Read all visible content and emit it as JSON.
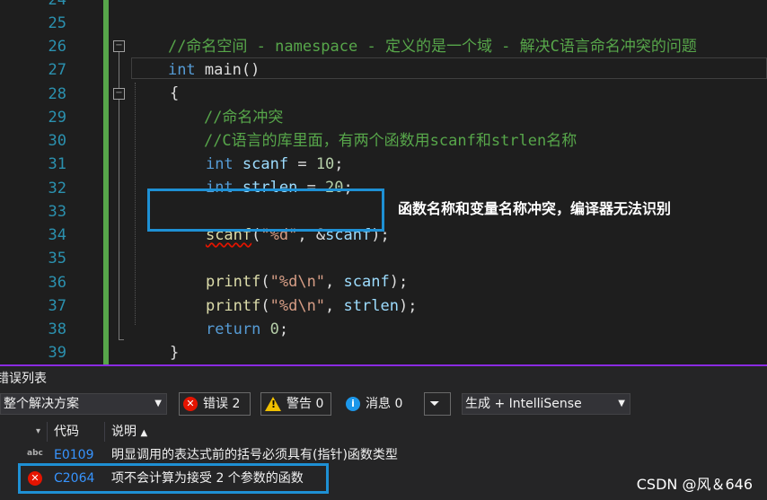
{
  "editor": {
    "line_numbers": [
      "24",
      "25",
      "26",
      "27",
      "28",
      "29",
      "30",
      "31",
      "32",
      "33",
      "34",
      "35",
      "36",
      "37",
      "38",
      "39"
    ],
    "lines": {
      "l25": {
        "comment": "//命名空间 - namespace - 定义的是一个域 - 解决C语言命名冲突的问题"
      },
      "l26": {
        "kw": "int",
        "rest": " main()"
      },
      "l27": {
        "text": "{"
      },
      "l28": {
        "comment": "//命名冲突"
      },
      "l29": {
        "comment": "//C语言的库里面，有两个函数用scanf和strlen名称"
      },
      "l30": {
        "kw": "int",
        "var": " scanf",
        "op": " = ",
        "num": "10",
        "end": ";"
      },
      "l31": {
        "kw": "int",
        "var": " strlen",
        "op": " = ",
        "num": "20",
        "end": ";"
      },
      "l33": {
        "fn": "scanf",
        "p1": "(",
        "str": "\"%d\"",
        "p2": ", &",
        "var": "scanf",
        "end": ");"
      },
      "l35": {
        "fn": "printf",
        "p1": "(",
        "str": "\"%d\\n\"",
        "p2": ", ",
        "var": "scanf",
        "end": ");"
      },
      "l36": {
        "fn": "printf",
        "p1": "(",
        "str": "\"%d\\n\"",
        "p2": ", ",
        "var": "strlen",
        "end": ");"
      },
      "l37": {
        "kw": "return",
        "rest": " ",
        "num": "0",
        "end": ";"
      },
      "l38": {
        "text": "}"
      }
    },
    "annotation": "函数名称和变量名称冲突，编译器无法识别"
  },
  "error_list": {
    "title": "错误列表",
    "scope_dropdown": "整个解决方案",
    "errors_label": "错误 2",
    "warnings_label": "警告 0",
    "messages_label": "消息 0",
    "source_dropdown": "生成 + IntelliSense",
    "columns": {
      "code": "代码",
      "description": "说明"
    },
    "rows": [
      {
        "code": "E0109",
        "description": "明显调用的表达式前的括号必须具有(指针)函数类型",
        "source_icon": "abc-intellisense-icon"
      },
      {
        "code": "C2064",
        "description": "项不会计算为接受 2 个参数的函数",
        "source_icon": "error-icon"
      }
    ]
  },
  "watermark": "CSDN @风＆646",
  "colors": {
    "accent_box": "#1e90d4",
    "error_red": "#e51400",
    "comment_green": "#57a64a",
    "keyword_blue": "#569cd6"
  }
}
